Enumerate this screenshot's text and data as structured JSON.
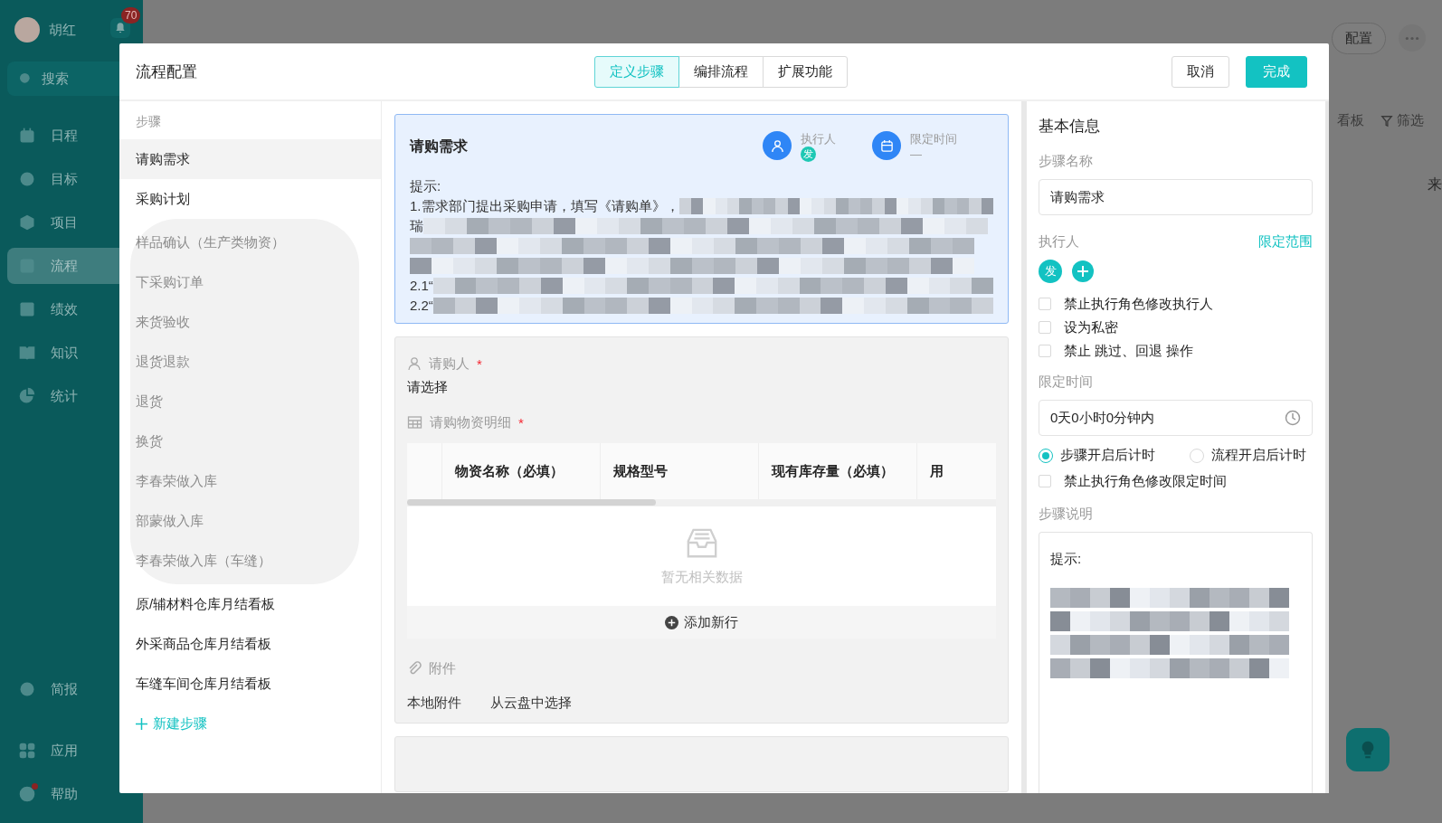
{
  "app_nav": {
    "user": {
      "name": "胡红"
    },
    "notification_count": "70",
    "search": {
      "placeholder": "搜索"
    },
    "items": [
      {
        "label": "日程",
        "selected": false
      },
      {
        "label": "目标",
        "selected": false
      },
      {
        "label": "项目",
        "selected": false
      },
      {
        "label": "流程",
        "selected": true
      },
      {
        "label": "绩效",
        "selected": false
      },
      {
        "label": "知识",
        "selected": false
      },
      {
        "label": "统计",
        "selected": false
      }
    ],
    "bottom_items": [
      {
        "label": "简报",
        "badge_dot": false
      },
      {
        "label": "应用",
        "badge_dot": false
      },
      {
        "label": "帮助",
        "badge_dot": true
      }
    ]
  },
  "backdrop": {
    "config_button": "配置",
    "view_buttons": [
      "看板",
      "筛选"
    ],
    "column_header": "来"
  },
  "modal": {
    "title": "流程配置",
    "tabs": [
      {
        "label": "定义步骤",
        "selected": true
      },
      {
        "label": "编排流程",
        "selected": false
      },
      {
        "label": "扩展功能",
        "selected": false
      }
    ],
    "buttons": [
      {
        "label": "取消",
        "kind": "secondary"
      },
      {
        "label": "完成",
        "kind": "primary"
      }
    ]
  },
  "steps": {
    "heading": "步骤",
    "items": [
      {
        "label": "请购需求",
        "selected": true,
        "obscured": false
      },
      {
        "label": "采购计划",
        "selected": false,
        "obscured": false
      },
      {
        "label": "样品确认（生产类物资）",
        "selected": false,
        "obscured": true
      },
      {
        "label": "下采购订单",
        "selected": false,
        "obscured": true
      },
      {
        "label": "来货验收",
        "selected": false,
        "obscured": true
      },
      {
        "label": "退货退款",
        "selected": false,
        "obscured": true
      },
      {
        "label": "退货",
        "selected": false,
        "obscured": true
      },
      {
        "label": "换货",
        "selected": false,
        "obscured": true
      },
      {
        "label": "李春荣做入库",
        "selected": false,
        "obscured": true
      },
      {
        "label": "部蒙做入库",
        "selected": false,
        "obscured": true
      },
      {
        "label": "李春荣做入库（车缝）",
        "selected": false,
        "obscured": true
      },
      {
        "label": "原/辅材料仓库月结看板",
        "selected": false,
        "obscured": false
      },
      {
        "label": "外采商品仓库月结看板",
        "selected": false,
        "obscured": false
      },
      {
        "label": "车缝车间仓库月结看板",
        "selected": false,
        "obscured": false
      }
    ],
    "add_button": "新建步骤"
  },
  "step_card": {
    "title": "请购需求",
    "selected": true,
    "executor": {
      "label": "执行人",
      "avatar": "发"
    },
    "time_limit": {
      "label": "限定时间",
      "value": "—"
    },
    "hint_lines": [
      {
        "text": "提示:",
        "redacted": false
      },
      {
        "text": "1.需求部门提出采购申请，填写《请购单》，",
        "redacted": true
      },
      {
        "text": "瑞",
        "redacted": true
      },
      {
        "redacted": true
      },
      {
        "redacted": true
      },
      {
        "text": "2.1“",
        "redacted": true
      },
      {
        "text": "2.2“",
        "redacted": true
      }
    ]
  },
  "form_card": {
    "fields": [
      {
        "kind": "person",
        "label": "请购人",
        "required_mark": "*",
        "value": "请选择"
      },
      {
        "kind": "table",
        "label": "请购物资明细",
        "required_mark": "*",
        "columns": [
          "物资名称（必填）",
          "规格型号",
          "现有库存量（必填）",
          "用"
        ],
        "empty_text": "暂无相关数据",
        "add_row": "添加新行"
      },
      {
        "kind": "attachment",
        "label": "附件",
        "actions": [
          "本地附件",
          "从云盘中选择"
        ]
      }
    ]
  },
  "basic_info": {
    "title": "基本信息",
    "step_name": {
      "label": "步骤名称",
      "value": "请购需求"
    },
    "executor": {
      "label": "执行人",
      "scope_link": "限定范围",
      "avatars": [
        "发"
      ]
    },
    "executor_options": [
      {
        "label": "禁止执行角色修改执行人",
        "checked": false
      },
      {
        "label": "设为私密",
        "checked": false
      },
      {
        "label": "禁止 跳过、回退 操作",
        "checked": false
      }
    ],
    "time_limit": {
      "label": "限定时间",
      "value": "0天0小时0分钟内"
    },
    "timing_modes": [
      {
        "label": "步骤开启后计时",
        "selected": true
      },
      {
        "label": "流程开启后计时",
        "selected": false
      }
    ],
    "time_options": [
      {
        "label": "禁止执行角色修改限定时间",
        "checked": false
      }
    ],
    "description": {
      "label": "步骤说明",
      "lines": [
        {
          "text": "提示:",
          "redacted": false
        },
        {
          "redacted": true
        },
        {
          "redacted": true
        },
        {
          "redacted": true
        },
        {
          "redacted": true
        }
      ]
    }
  }
}
